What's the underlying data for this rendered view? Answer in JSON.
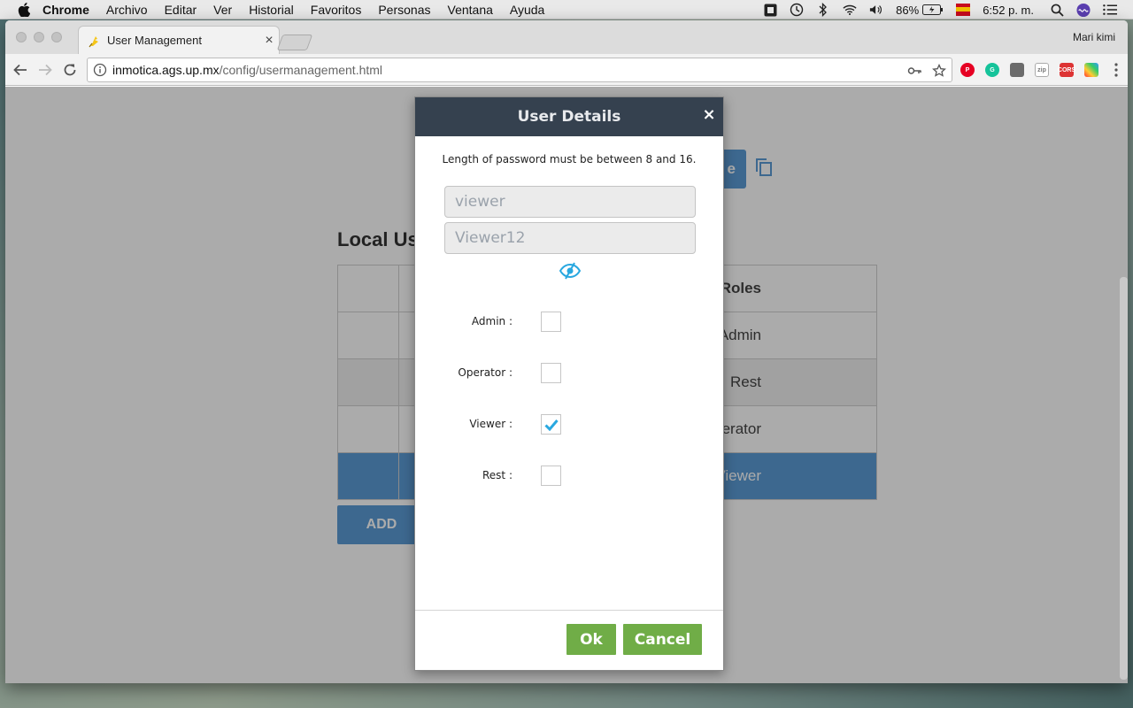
{
  "menubar": {
    "items": [
      "Chrome",
      "Archivo",
      "Editar",
      "Ver",
      "Historial",
      "Favoritos",
      "Personas",
      "Ventana",
      "Ayuda"
    ],
    "battery": "86%",
    "time": "6:52 p. m."
  },
  "browser": {
    "tab_title": "User Management",
    "tab_close": "×",
    "profile_name": "Mari kimi",
    "url_host": "inmotica.ags.up.mx",
    "url_path": "/config/usermanagement.html"
  },
  "page": {
    "save_button_partial": "e",
    "section_title": "Local Us",
    "table": {
      "header_role": "Roles",
      "rows": [
        {
          "role": "Admin"
        },
        {
          "role": "Rest"
        },
        {
          "role": "perator"
        },
        {
          "role": "Viewer"
        }
      ]
    },
    "add_button": "ADD"
  },
  "modal": {
    "title": "User Details",
    "close_glyph": "×",
    "password_note": "Length of password must be between 8 and 16.",
    "username_value": "viewer",
    "password_value": "Viewer12",
    "roles": [
      {
        "label": "Admin :",
        "checked": false
      },
      {
        "label": "Operator :",
        "checked": false
      },
      {
        "label": "Viewer :",
        "checked": true
      },
      {
        "label": "Rest :",
        "checked": false
      }
    ],
    "ok_label": "Ok",
    "cancel_label": "Cancel"
  },
  "colors": {
    "modal_header": "#35414f",
    "accent_green": "#70ad47",
    "accent_blue": "#5b9bd5",
    "check_blue": "#29a8e0"
  },
  "icons": [
    "apple-icon",
    "time-machine-icon",
    "bluetooth-icon",
    "wifi-icon",
    "volume-icon",
    "battery-icon",
    "search-icon",
    "siri-icon",
    "notification-center-icon",
    "back-icon",
    "forward-icon",
    "reload-icon",
    "info-icon",
    "key-icon",
    "star-icon",
    "pinterest-icon",
    "grammarly-icon",
    "eye-visibility-icon",
    "copy-icon",
    "close-icon",
    "check-icon"
  ]
}
